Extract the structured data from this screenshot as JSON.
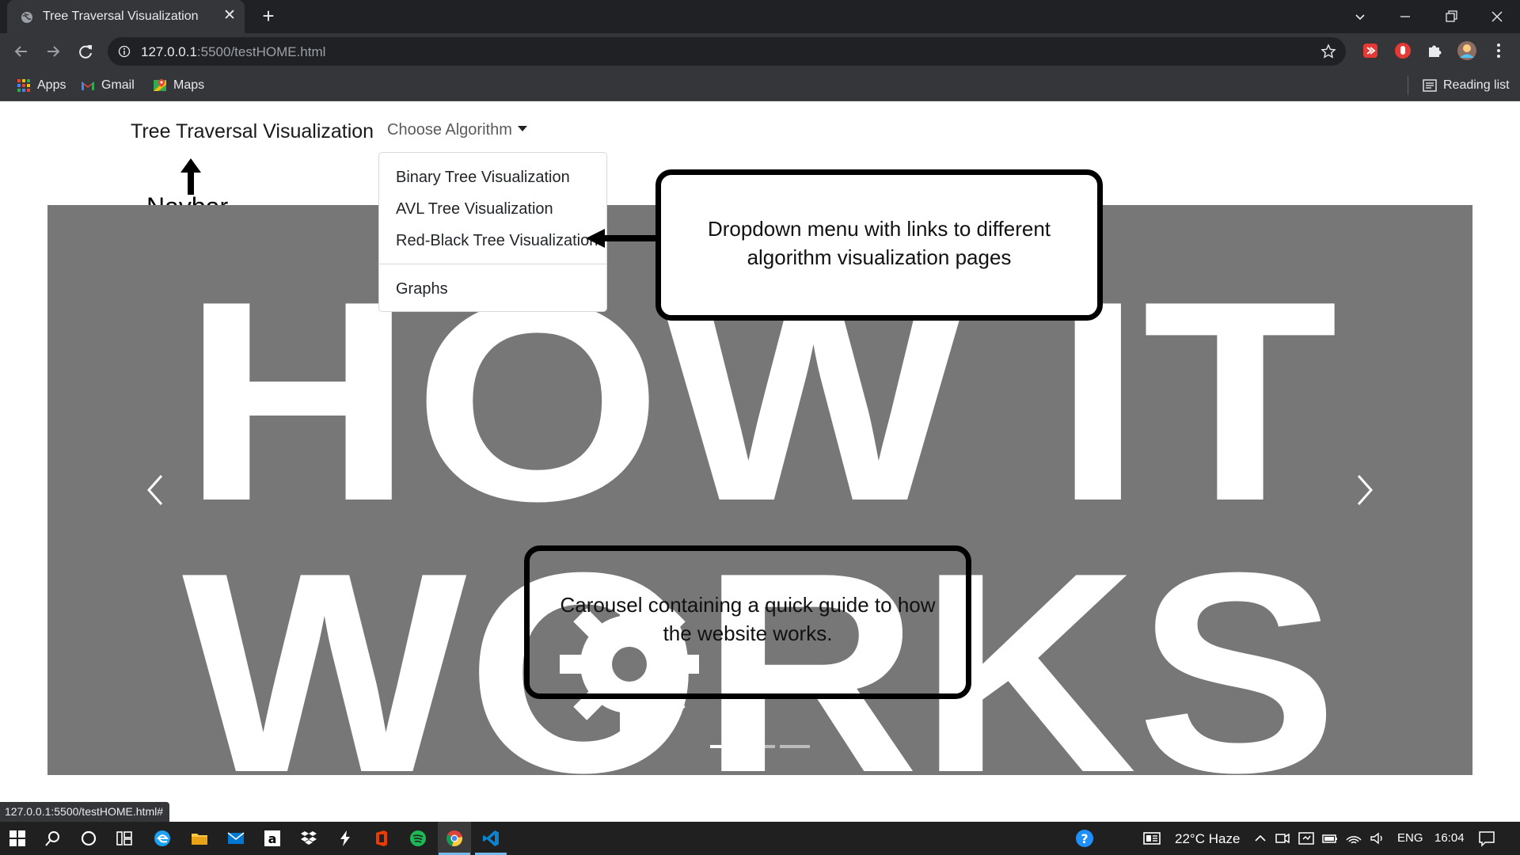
{
  "browser": {
    "tab_title": "Tree Traversal Visualization",
    "url_host": "127.0.0.1",
    "url_rest": ":5500/testHOME.html",
    "bookmarks": [
      {
        "label": "Apps",
        "icon": "apps-grid-icon"
      },
      {
        "label": "Gmail",
        "icon": "gmail-icon"
      },
      {
        "label": "Maps",
        "icon": "maps-icon"
      }
    ],
    "reading_list": "Reading list",
    "status_url": "127.0.0.1:5500/testHOME.html#"
  },
  "page": {
    "brand": "Tree Traversal Visualization",
    "dropdown_label": "Choose Algorithm",
    "dropdown_items": [
      "Binary Tree Visualization",
      "AVL Tree Visualization",
      "Red-Black Tree Visualization"
    ],
    "dropdown_extra_item": "Graphs",
    "carousel": {
      "slide_text_line1": "HOW IT",
      "slide_text_line2": "WORKS",
      "slide_count": 3,
      "active_slide": 1
    }
  },
  "annotations": {
    "navbar_label": "Navbar",
    "dropdown_note_line1": "Dropdown menu with links to different",
    "dropdown_note_line2": "algorithm visualization pages",
    "carousel_note_line1": "Carousel containing a quick guide to how",
    "carousel_note_line2": "the website works."
  },
  "taskbar": {
    "weather": "22°C  Haze",
    "language": "ENG",
    "time": "16:04"
  },
  "colors": {
    "chrome_dark": "#202124",
    "chrome_mid": "#35363a",
    "carousel_bg": "#777777",
    "taskbar": "#202020"
  }
}
